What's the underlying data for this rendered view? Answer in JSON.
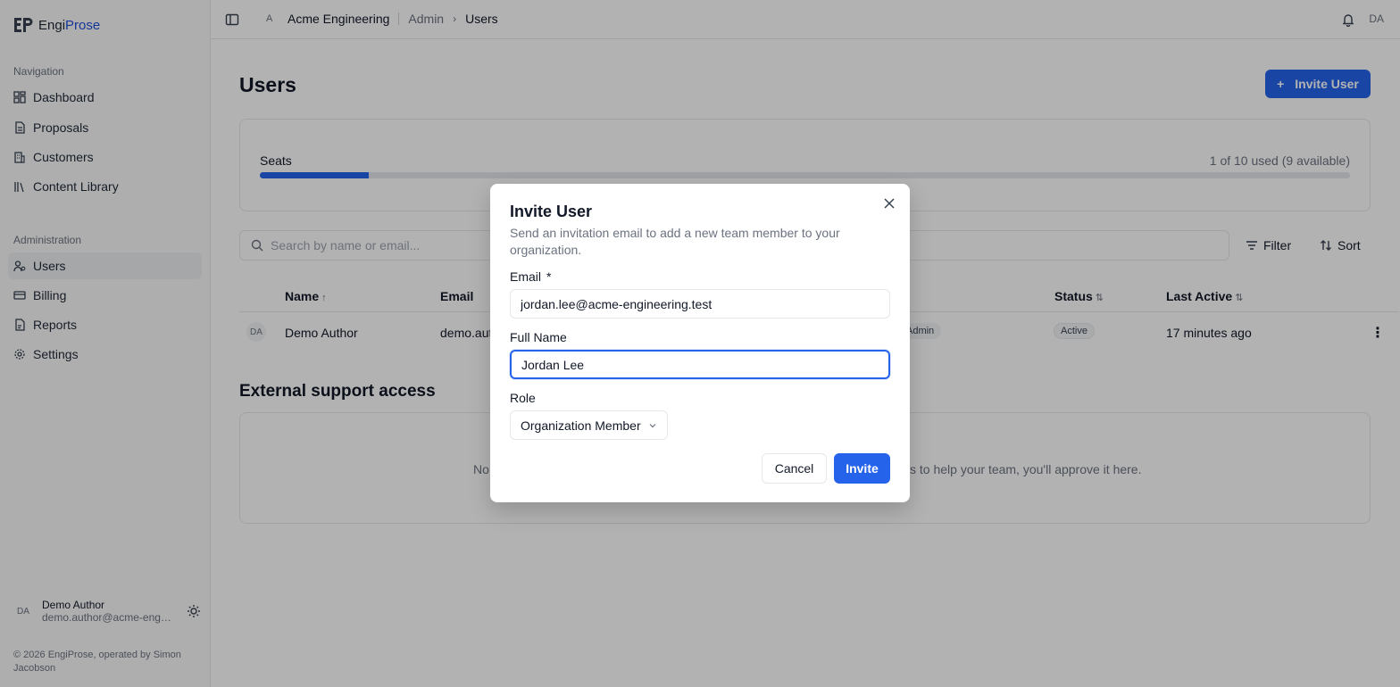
{
  "brand": {
    "logo_left": "Engi",
    "logo_right": "Prose"
  },
  "sidebar": {
    "nav_section": "Navigation",
    "nav_items": [
      {
        "label": "Dashboard",
        "icon": "dashboard-icon"
      },
      {
        "label": "Proposals",
        "icon": "document-icon"
      },
      {
        "label": "Customers",
        "icon": "building-icon"
      },
      {
        "label": "Content Library",
        "icon": "library-icon"
      }
    ],
    "admin_section": "Administration",
    "admin_items": [
      {
        "label": "Users",
        "icon": "users-icon",
        "active": true
      },
      {
        "label": "Billing",
        "icon": "card-icon"
      },
      {
        "label": "Reports",
        "icon": "report-icon"
      },
      {
        "label": "Settings",
        "icon": "gear-icon"
      }
    ],
    "user": {
      "initials": "DA",
      "name": "Demo Author",
      "email": "demo.author@acme-engi..."
    },
    "footer": "© 2026 EngiProse, operated by Simon Jacobson"
  },
  "topbar": {
    "org_initial": "A",
    "org_name": "Acme Engineering",
    "crumb_admin": "Admin",
    "crumb_current": "Users",
    "avatar": "DA"
  },
  "main": {
    "title": "Users",
    "invite_button": "Invite User",
    "seats": {
      "label": "Seats",
      "count_text": "1 of 10 used (9 available)",
      "used": 1,
      "total": 10
    },
    "search_placeholder": "Search by name or email...",
    "filter_label": "Filter",
    "sort_label": "Sort",
    "table": {
      "headers": {
        "name": "Name",
        "email": "Email",
        "status": "Status",
        "last_active": "Last Active"
      },
      "rows": [
        {
          "initials": "DA",
          "name": "Demo Author",
          "email": "demo.aut",
          "role": "Admin",
          "status": "Active",
          "last_active": "17 minutes ago"
        }
      ]
    },
    "support_title": "External support access",
    "support_text_left": "No",
    "support_text_right": "s to help your team, you'll approve it here."
  },
  "modal": {
    "title": "Invite User",
    "description": "Send an invitation email to add a new team member to your organization.",
    "email_label": "Email",
    "email_required": "*",
    "email_value": "jordan.lee@acme-engineering.test",
    "name_label": "Full Name",
    "name_value": "Jordan Lee",
    "role_label": "Role",
    "role_value": "Organization Member",
    "cancel_label": "Cancel",
    "invite_label": "Invite"
  },
  "colors": {
    "accent": "#2563eb",
    "overlay": "rgba(0,0,0,0.30)"
  }
}
